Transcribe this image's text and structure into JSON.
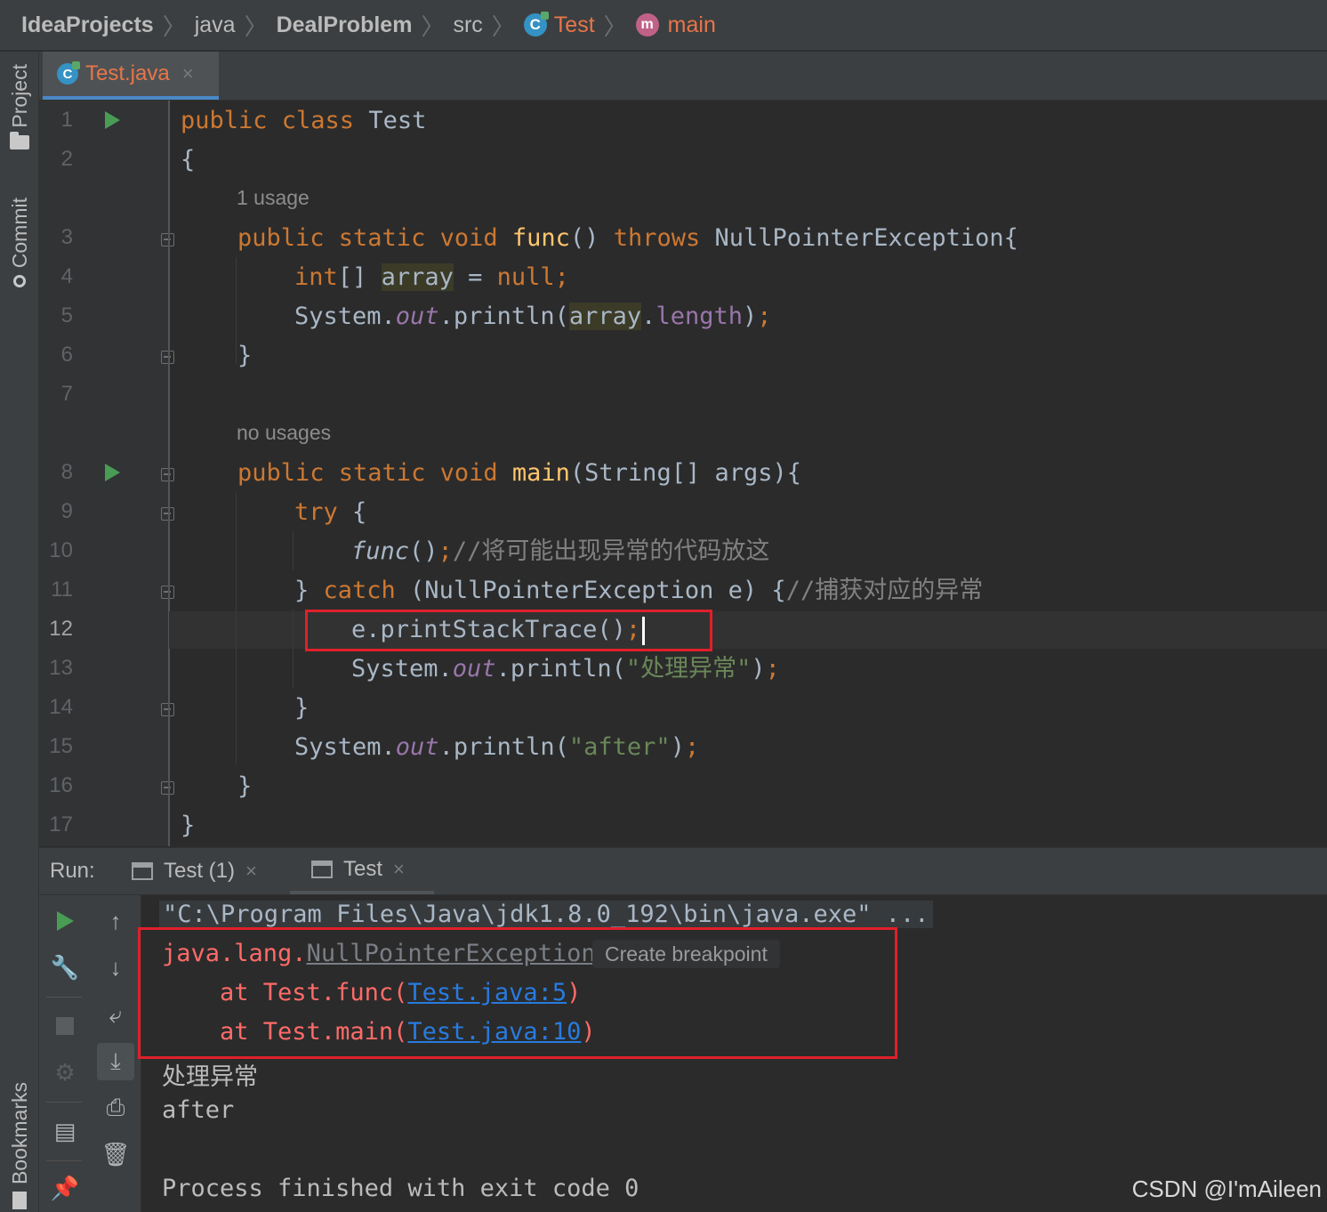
{
  "breadcrumb": {
    "items": [
      "IdeaProjects",
      "java",
      "DealProblem",
      "src",
      "Test",
      "main"
    ],
    "class_icon_letter": "C",
    "method_icon_letter": "m"
  },
  "sidebar": {
    "project_label": "Project",
    "commit_label": "Commit",
    "bookmarks_label": "Bookmarks"
  },
  "editor": {
    "tab": {
      "label": "Test.java",
      "icon_letter": "C",
      "close": "×"
    },
    "hints": {
      "line3": "1 usage",
      "line8": "no usages"
    },
    "line_numbers": [
      "1",
      "2",
      "3",
      "4",
      "5",
      "6",
      "7",
      "8",
      "9",
      "10",
      "11",
      "12",
      "13",
      "14",
      "15",
      "16",
      "17"
    ],
    "current_line": "12",
    "code": {
      "l1_kw": "public class",
      "l1_name": " Test",
      "l2": "{",
      "l3_kw": "public static void",
      "l3_fn": "func",
      "l3_paren": "()",
      "l3_kw2": "throws",
      "l3_rest": " NullPointerException{",
      "l4_kw": "int",
      "l4_br": "[] ",
      "l4_var": "array",
      "l4_eq": " = ",
      "l4_null": "null",
      "l4_semi": ";",
      "l5_sys": "System.",
      "l5_out": "out",
      "l5_call": ".println(",
      "l5_var": "array",
      "l5_dot": ".",
      "l5_len": "length",
      "l5_end": ")",
      "l5_semi": ";",
      "l6": "}",
      "l8_kw": "public static void",
      "l8_fn": "main",
      "l8_rest": "(String[] args){",
      "l9_kw": "try",
      "l9_rest": " {",
      "l10_fn": "func",
      "l10_paren": "()",
      "l10_semi": ";",
      "l10_cm": "//将可能出现异常的代码放这",
      "l11_br": "} ",
      "l11_kw": "catch",
      "l11_rest": " (NullPointerException e) {",
      "l11_cm": "//捕获对应的异常",
      "l12_code": "e.printStackTrace()",
      "l12_semi": ";",
      "l13_sys": "System.",
      "l13_out": "out",
      "l13_call": ".println(",
      "l13_str": "\"处理异常\"",
      "l13_end": ")",
      "l13_semi": ";",
      "l14": "}",
      "l15_sys": "System.",
      "l15_out": "out",
      "l15_call": ".println(",
      "l15_str": "\"after\"",
      "l15_end": ")",
      "l15_semi": ";",
      "l16": "}",
      "l17": "}"
    }
  },
  "run_panel": {
    "label": "Run:",
    "tabs": [
      {
        "label": "Test (1)",
        "close": "×"
      },
      {
        "label": "Test",
        "close": "×"
      }
    ],
    "console": {
      "cmd": "\"C:\\Program Files\\Java\\jdk1.8.0_192\\bin\\java.exe\" ...",
      "exc_prefix": "java.lang.",
      "exc_name": "NullPointerException",
      "tooltip": "Create breakpoint",
      "at1_prefix": "    at Test.func(",
      "at1_link": "Test.java:5",
      "at1_suffix": ")",
      "at2_prefix": "    at Test.main(",
      "at2_link": "Test.java:10",
      "at2_suffix": ")",
      "out1": "处理异常",
      "out2": "after",
      "finish": "Process finished with exit code 0"
    }
  },
  "watermark": "CSDN @I'mAileen",
  "colors": {
    "keyword": "#cc7832",
    "function": "#ffc66d",
    "field": "#9876aa",
    "string": "#6a8759",
    "comment": "#808080",
    "error": "#ff6b68",
    "link": "#287bde",
    "highlight_box": "#e0202a",
    "run_green": "#499c54"
  }
}
